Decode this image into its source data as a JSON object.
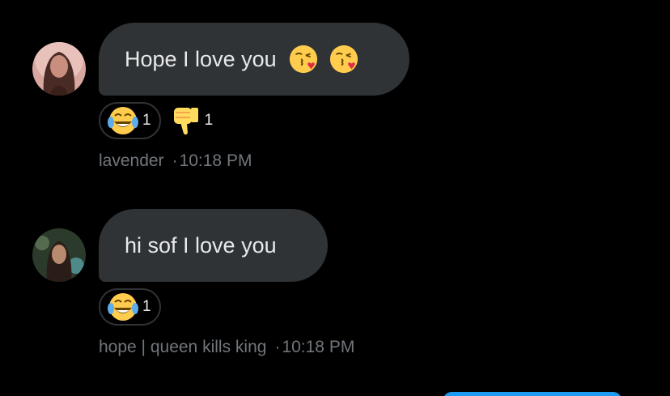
{
  "messages": [
    {
      "text": "Hope I love you",
      "emojis": [
        "face-blowing-kiss",
        "face-blowing-kiss"
      ],
      "reactions": [
        {
          "emoji": "face-with-tears-of-joy",
          "count": "1",
          "outlined": true
        },
        {
          "emoji": "thumbs-down",
          "count": "1",
          "outlined": false
        }
      ],
      "sender": "lavender",
      "separator": "·",
      "time": "10:18 PM"
    },
    {
      "text": "hi sof I love you",
      "emojis": [],
      "reactions": [
        {
          "emoji": "face-with-tears-of-joy",
          "count": "1",
          "outlined": true
        }
      ],
      "sender": "hope | queen kills king",
      "separator": "·",
      "time": "10:18 PM"
    }
  ],
  "colors": {
    "background": "#000000",
    "bubble": "#2f3336",
    "text": "#e7e9ea",
    "meta_text": "#71767b",
    "accent": "#1d9bf0"
  }
}
